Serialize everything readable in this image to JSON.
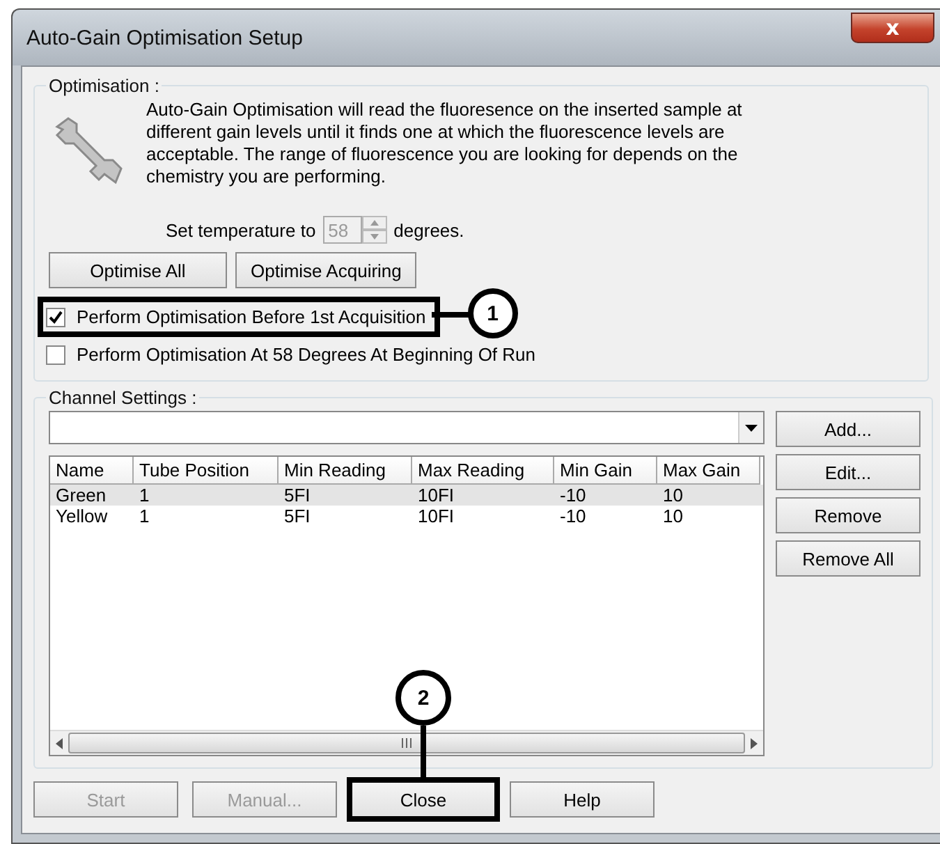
{
  "window": {
    "title": "Auto-Gain Optimisation Setup",
    "close": "x"
  },
  "optimisation": {
    "legend": "Optimisation :",
    "description": "Auto-Gain Optimisation will read the fluoresence on the inserted sample at different gain levels until it finds one at which the fluorescence levels are acceptable. The range of fluorescence you are looking for depends on the chemistry you are performing.",
    "temperature_label": "Set temperature to",
    "temperature_value": "58",
    "temperature_unit": "degrees.",
    "temperature_disabled": true,
    "buttons": [
      "Optimise All",
      "Optimise Acquiring"
    ],
    "checkboxes": [
      {
        "label": "Perform Optimisation Before 1st Acquisition",
        "checked": true,
        "highlighted": true,
        "callout": "1"
      },
      {
        "label": "Perform Optimisation At 58 Degrees At Beginning Of Run",
        "checked": false,
        "highlighted": false
      }
    ]
  },
  "channel_settings": {
    "legend": "Channel Settings :",
    "columns": [
      "Name",
      "Tube Position",
      "Min Reading",
      "Max Reading",
      "Min Gain",
      "Max Gain"
    ],
    "rows": [
      {
        "cells": [
          "Green",
          "1",
          "5FI",
          "10FI",
          "-10",
          "10"
        ],
        "selected": true
      },
      {
        "cells": [
          "Yellow",
          "1",
          "5FI",
          "10FI",
          "-10",
          "10"
        ],
        "selected": false
      }
    ],
    "side_buttons": [
      "Add...",
      "Edit...",
      "Remove",
      "Remove All"
    ]
  },
  "buttons": [
    {
      "label": "Start",
      "disabled": true,
      "highlighted": false
    },
    {
      "label": "Manual...",
      "disabled": true,
      "highlighted": false
    },
    {
      "label": "Close",
      "disabled": false,
      "highlighted": true,
      "callout": "2"
    },
    {
      "label": "Help",
      "disabled": false,
      "highlighted": false
    }
  ]
}
